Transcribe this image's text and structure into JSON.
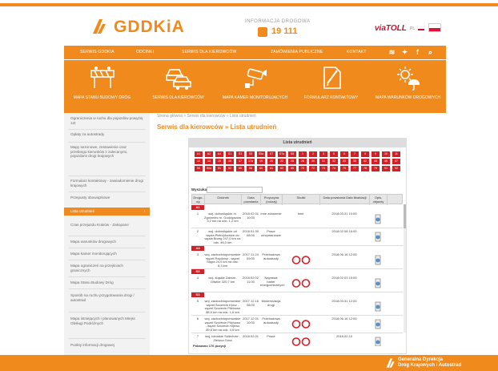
{
  "header": {
    "logo_text": "GDDKiA",
    "info_label": "INFORMACJA DROGOWA",
    "phone": "19 111",
    "viatoll": "viaTOLL",
    "lang": "PL"
  },
  "nav": {
    "items": [
      "SERWIS GDDKiA",
      "ODCINKI",
      "SERWIS DLA KIEROWCÓW",
      "ZAMÓWIENIA PUBLICZNE",
      "KONTAKT"
    ]
  },
  "tiles": [
    {
      "label": "MAPA STANU BUDOWY DRÓG",
      "icon": "roadblock-icon"
    },
    {
      "label": "SERWIS DLA KIEROWCÓW",
      "icon": "cars-icon"
    },
    {
      "label": "MAPA KAMER MONITORUJĄCYCH",
      "icon": "camera-icon"
    },
    {
      "label": "FORMULARZ KONTAKTOWY",
      "icon": "form-icon"
    },
    {
      "label": "MAPA WARUNKÓW DROGOWYCH",
      "icon": "weather-icon"
    }
  ],
  "sidebar": {
    "items": [
      "Ograniczenia w ruchu dla pojazdów powyżej 12t",
      "Opłaty za autostrady",
      "Mapy sezonowe, zestawienie oraz przebiegu kierunków z zalecanymi, pojazdami drogi krajowych",
      "Formularz kontaktowy - zawiadomienie drogi krajowych",
      "Przepusty obowiązkowe",
      "Lista utrudnień",
      "Czas przejazdu Kraków - Zakopane",
      "Mapa warunków drogowych",
      "Mapa kamer monitorujących",
      "Mapa ograniczeń na przejściach granicznych",
      "Mapa Stanu Budowy Dróg",
      "Sposób na ruchu przygotowania drogi / autostrad",
      "Mapa istniejących i planowanych Miejsc Obsługi Podróżnych",
      "Punkty informacji drogowej"
    ],
    "active_index": 5
  },
  "breadcrumb": "Strona główna » Serwis dla kierowców » Lista utrudnień",
  "page_title": "Serwis dla kierowców » Lista utrudnień",
  "panel": {
    "title": "Lista utrudnień",
    "chips": [
      "A1",
      "A2",
      "A4",
      "S1",
      "S3",
      "S5",
      "S5a",
      "S7",
      "S7a",
      "S8",
      "1",
      "2",
      "3",
      "5",
      "6",
      "7",
      "8",
      "9",
      "10",
      "11",
      "12",
      "13",
      "15",
      "16",
      "17",
      "17a",
      "19",
      "20",
      "22",
      "25",
      "28",
      "30",
      "31",
      "32",
      "33",
      "35",
      "42",
      "45",
      "46",
      "47",
      "50",
      "50a",
      "51",
      "52",
      "55",
      "56",
      "60",
      "61",
      "62",
      "65",
      "70",
      "72",
      "73",
      "74",
      "75",
      "77",
      "78",
      "79",
      "91",
      "92"
    ],
    "search_label": "Wyszukaj:",
    "columns": [
      "Drogo-wy",
      "Odcinek",
      "Data powstania",
      "Przyczyna (rodzaj)",
      "Skutki",
      "Data powstania Data likwidacji",
      "Opis, objazdy"
    ],
    "groups": [
      {
        "label": "A1",
        "rows": [
          {
            "no": "1",
            "segment": "woj. dolnośląskie m. Zgorzelec m. Godzięszów 3,2 km na odc. 1,2 km",
            "date": "2018.02.01 10:00",
            "cause": "Inne zdarzenie",
            "effect": "Inne",
            "end": "2018.03.31 10:00"
          },
          {
            "no": "2",
            "segment": "woj. dolnośląskie od węzła Pietrzykowice do węzła Brzeg 247,0 km na odc. 46,0 km",
            "date": "2018.01.30 08:00",
            "cause": "Prace utrzymaniowe",
            "effect": "",
            "end": "2018.02.08 16:00"
          }
        ]
      },
      {
        "label": "A4",
        "rows": [
          {
            "no": "3",
            "segment": "woj. zachodniopomorskie węzeł Rzędziny - węzeł Stępa 24,9 km na odc. 8,3 km",
            "date": "2017.11.24 09:00",
            "cause": "Przebudowa autostrady",
            "effect": "sign",
            "end": "2018.06.16 12:00"
          }
        ]
      },
      {
        "label": "S3",
        "rows": [
          {
            "no": "4",
            "segment": "woj. śląskie Zabrze-Gliwice 320,7 km",
            "date": "2018.02.02 11:00",
            "cause": "Naprawa barier energochłonnych",
            "effect": "sign",
            "end": "2018.02.03 15:00"
          }
        ]
      },
      {
        "label": "S3",
        "rows": [
          {
            "no": "5",
            "segment": "woj. zachodniopomorskie węzeł Szczecin Klucz - węzeł Szczecin Pilchowo 88,0 km na odc. 1,6 km",
            "date": "2017.12.16 08:00",
            "cause": "Modernizacja drogi",
            "effect": "",
            "end": "2018.03.31 12:00"
          },
          {
            "no": "6",
            "segment": "woj. zachodniopomorskie węzeł Szczecin Pilchowo - węzeł Szczecin Kijewo 89,6 km na odc. 4,6 km",
            "date": "2017.12.01 10:00",
            "cause": "Przebudowa autostrady",
            "effect": "sign",
            "end": "2018.06.16 12:00"
          },
          {
            "no": "7",
            "segment": "woj. lubuskie Sulechów - Zielona Góra",
            "date": "2018.02.01",
            "cause": "Prace",
            "effect": "sign",
            "end": "2018.02.10"
          }
        ]
      }
    ],
    "footer_note": "Pokazano 176 pozycji"
  },
  "footer": {
    "line1": "Generalna Dyrekcja",
    "line2": "Dróg Krajowych i Autostrad"
  }
}
